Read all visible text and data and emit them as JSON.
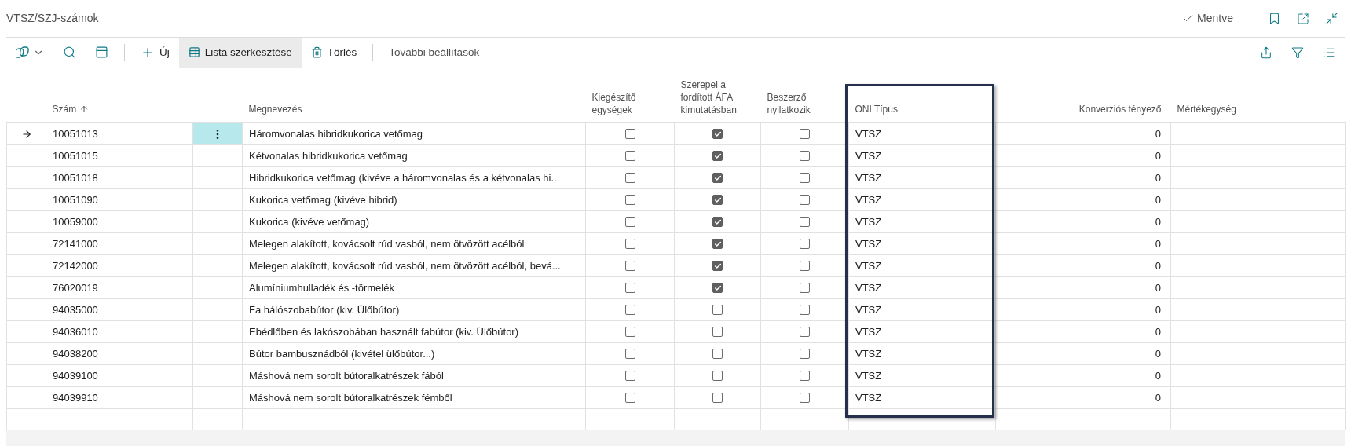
{
  "page": {
    "title": "VTSZ/SZJ-számok",
    "status": "Mentve"
  },
  "toolbar": {
    "buttons": [
      {
        "kind": "new",
        "label": "Új",
        "selected": false
      },
      {
        "kind": "edit-list",
        "label": "Lista szerkesztése",
        "selected": true
      },
      {
        "kind": "delete",
        "label": "Törlés",
        "selected": false
      }
    ],
    "more": "További beállítások"
  },
  "table": {
    "columns": [
      {
        "kind": "text",
        "label": "Szám",
        "sorted": true,
        "highlighted": false
      },
      {
        "kind": "text",
        "label": "Megnevezés",
        "sorted": false,
        "highlighted": false
      },
      {
        "kind": "checkbox",
        "label": "Kiegészítő egységek",
        "sorted": false,
        "highlighted": false
      },
      {
        "kind": "checkbox",
        "label": "Szerepel a fordított ÁFA kimutatásban",
        "sorted": false,
        "highlighted": false
      },
      {
        "kind": "checkbox",
        "label": "Beszerző nyilatkozik",
        "sorted": false,
        "highlighted": false
      },
      {
        "kind": "text",
        "label": "ONI Típus",
        "sorted": false,
        "highlighted": true
      },
      {
        "kind": "number",
        "label": "Konverziós tényező",
        "sorted": false,
        "highlighted": false
      },
      {
        "kind": "text",
        "label": "Mértékegység",
        "sorted": false,
        "highlighted": false
      }
    ],
    "rows": [
      {
        "selected": true,
        "cells": [
          "10051013",
          "Háromvonalas hibridkukorica vetőmag",
          false,
          true,
          false,
          "VTSZ",
          "0"
        ]
      },
      {
        "selected": false,
        "cells": [
          "10051015",
          "Kétvonalas hibridkukorica vetőmag",
          false,
          true,
          false,
          "VTSZ",
          "0"
        ]
      },
      {
        "selected": false,
        "cells": [
          "10051018",
          "Hibridkukorica vetőmag (kivéve a háromvonalas és a kétvonalas hi...",
          false,
          true,
          false,
          "VTSZ",
          "0"
        ]
      },
      {
        "selected": false,
        "cells": [
          "10051090",
          "Kukorica vetőmag (kivéve hibrid)",
          false,
          true,
          false,
          "VTSZ",
          "0"
        ]
      },
      {
        "selected": false,
        "cells": [
          "10059000",
          "Kukorica (kivéve vetőmag)",
          false,
          true,
          false,
          "VTSZ",
          "0"
        ]
      },
      {
        "selected": false,
        "cells": [
          "72141000",
          "Melegen alakított, kovácsolt rúd vasból, nem ötvözött acélból",
          false,
          true,
          false,
          "VTSZ",
          "0"
        ]
      },
      {
        "selected": false,
        "cells": [
          "72142000",
          "Melegen alakított, kovácsolt rúd vasból, nem ötvözött acélból, bevá...",
          false,
          true,
          false,
          "VTSZ",
          "0"
        ]
      },
      {
        "selected": false,
        "cells": [
          "76020019",
          "Alumíniumhulladék és -törmelék",
          false,
          true,
          false,
          "VTSZ",
          "0"
        ]
      },
      {
        "selected": false,
        "cells": [
          "94035000",
          "Fa hálószobabútor (kiv. Ülőbútor)",
          false,
          false,
          false,
          "VTSZ",
          "0"
        ]
      },
      {
        "selected": false,
        "cells": [
          "94036010",
          "Ebédlőben és lakószobában használt fabútor (kiv. Ülőbútor)",
          false,
          false,
          false,
          "VTSZ",
          "0"
        ]
      },
      {
        "selected": false,
        "cells": [
          "94038200",
          "Bútor bambusznádból (kivétel ülőbútor...)",
          false,
          false,
          false,
          "VTSZ",
          "0"
        ]
      },
      {
        "selected": false,
        "cells": [
          "94039100",
          "Máshová nem sorolt bútoralkatrészek fából",
          false,
          false,
          false,
          "VTSZ",
          "0"
        ]
      },
      {
        "selected": false,
        "cells": [
          "94039910",
          "Máshová nem sorolt bútoralkatrészek fémből",
          false,
          false,
          false,
          "VTSZ",
          "0"
        ]
      }
    ]
  }
}
